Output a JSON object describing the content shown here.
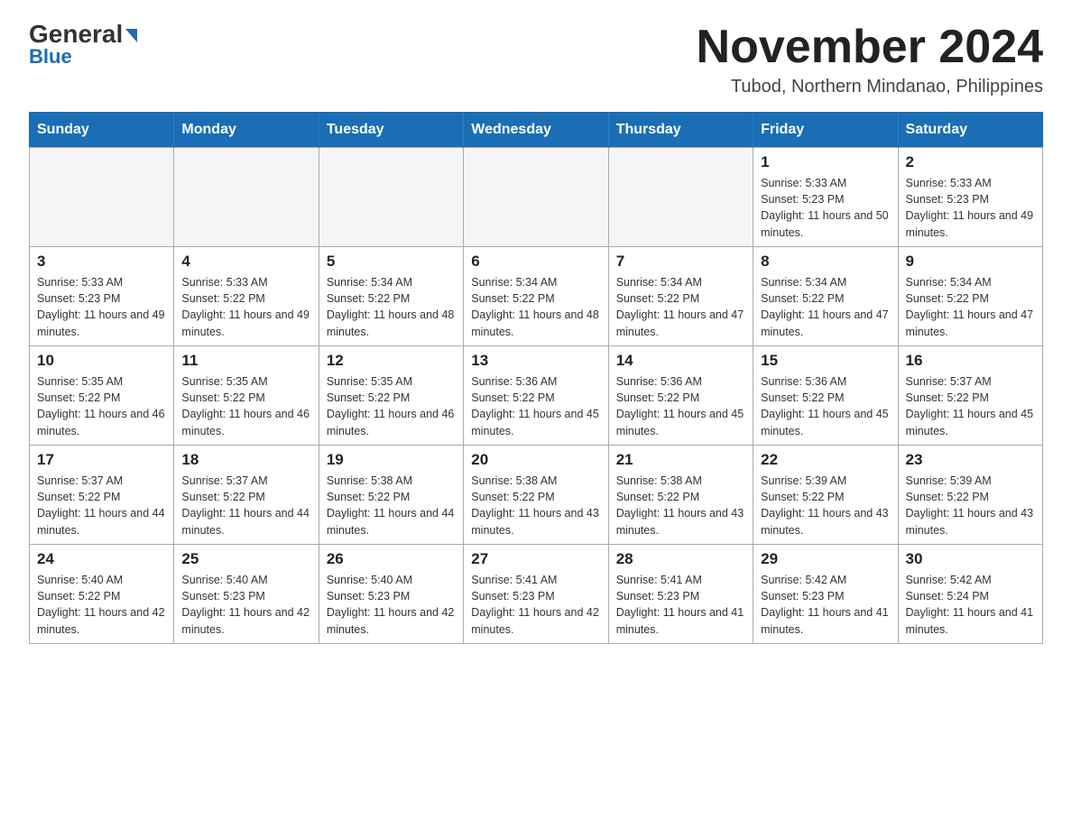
{
  "header": {
    "logo_top": "General",
    "logo_blue": "Blue",
    "month_title": "November 2024",
    "location": "Tubod, Northern Mindanao, Philippines"
  },
  "weekdays": [
    "Sunday",
    "Monday",
    "Tuesday",
    "Wednesday",
    "Thursday",
    "Friday",
    "Saturday"
  ],
  "weeks": [
    [
      {
        "day": "",
        "info": ""
      },
      {
        "day": "",
        "info": ""
      },
      {
        "day": "",
        "info": ""
      },
      {
        "day": "",
        "info": ""
      },
      {
        "day": "",
        "info": ""
      },
      {
        "day": "1",
        "info": "Sunrise: 5:33 AM\nSunset: 5:23 PM\nDaylight: 11 hours and 50 minutes."
      },
      {
        "day": "2",
        "info": "Sunrise: 5:33 AM\nSunset: 5:23 PM\nDaylight: 11 hours and 49 minutes."
      }
    ],
    [
      {
        "day": "3",
        "info": "Sunrise: 5:33 AM\nSunset: 5:23 PM\nDaylight: 11 hours and 49 minutes."
      },
      {
        "day": "4",
        "info": "Sunrise: 5:33 AM\nSunset: 5:22 PM\nDaylight: 11 hours and 49 minutes."
      },
      {
        "day": "5",
        "info": "Sunrise: 5:34 AM\nSunset: 5:22 PM\nDaylight: 11 hours and 48 minutes."
      },
      {
        "day": "6",
        "info": "Sunrise: 5:34 AM\nSunset: 5:22 PM\nDaylight: 11 hours and 48 minutes."
      },
      {
        "day": "7",
        "info": "Sunrise: 5:34 AM\nSunset: 5:22 PM\nDaylight: 11 hours and 47 minutes."
      },
      {
        "day": "8",
        "info": "Sunrise: 5:34 AM\nSunset: 5:22 PM\nDaylight: 11 hours and 47 minutes."
      },
      {
        "day": "9",
        "info": "Sunrise: 5:34 AM\nSunset: 5:22 PM\nDaylight: 11 hours and 47 minutes."
      }
    ],
    [
      {
        "day": "10",
        "info": "Sunrise: 5:35 AM\nSunset: 5:22 PM\nDaylight: 11 hours and 46 minutes."
      },
      {
        "day": "11",
        "info": "Sunrise: 5:35 AM\nSunset: 5:22 PM\nDaylight: 11 hours and 46 minutes."
      },
      {
        "day": "12",
        "info": "Sunrise: 5:35 AM\nSunset: 5:22 PM\nDaylight: 11 hours and 46 minutes."
      },
      {
        "day": "13",
        "info": "Sunrise: 5:36 AM\nSunset: 5:22 PM\nDaylight: 11 hours and 45 minutes."
      },
      {
        "day": "14",
        "info": "Sunrise: 5:36 AM\nSunset: 5:22 PM\nDaylight: 11 hours and 45 minutes."
      },
      {
        "day": "15",
        "info": "Sunrise: 5:36 AM\nSunset: 5:22 PM\nDaylight: 11 hours and 45 minutes."
      },
      {
        "day": "16",
        "info": "Sunrise: 5:37 AM\nSunset: 5:22 PM\nDaylight: 11 hours and 45 minutes."
      }
    ],
    [
      {
        "day": "17",
        "info": "Sunrise: 5:37 AM\nSunset: 5:22 PM\nDaylight: 11 hours and 44 minutes."
      },
      {
        "day": "18",
        "info": "Sunrise: 5:37 AM\nSunset: 5:22 PM\nDaylight: 11 hours and 44 minutes."
      },
      {
        "day": "19",
        "info": "Sunrise: 5:38 AM\nSunset: 5:22 PM\nDaylight: 11 hours and 44 minutes."
      },
      {
        "day": "20",
        "info": "Sunrise: 5:38 AM\nSunset: 5:22 PM\nDaylight: 11 hours and 43 minutes."
      },
      {
        "day": "21",
        "info": "Sunrise: 5:38 AM\nSunset: 5:22 PM\nDaylight: 11 hours and 43 minutes."
      },
      {
        "day": "22",
        "info": "Sunrise: 5:39 AM\nSunset: 5:22 PM\nDaylight: 11 hours and 43 minutes."
      },
      {
        "day": "23",
        "info": "Sunrise: 5:39 AM\nSunset: 5:22 PM\nDaylight: 11 hours and 43 minutes."
      }
    ],
    [
      {
        "day": "24",
        "info": "Sunrise: 5:40 AM\nSunset: 5:22 PM\nDaylight: 11 hours and 42 minutes."
      },
      {
        "day": "25",
        "info": "Sunrise: 5:40 AM\nSunset: 5:23 PM\nDaylight: 11 hours and 42 minutes."
      },
      {
        "day": "26",
        "info": "Sunrise: 5:40 AM\nSunset: 5:23 PM\nDaylight: 11 hours and 42 minutes."
      },
      {
        "day": "27",
        "info": "Sunrise: 5:41 AM\nSunset: 5:23 PM\nDaylight: 11 hours and 42 minutes."
      },
      {
        "day": "28",
        "info": "Sunrise: 5:41 AM\nSunset: 5:23 PM\nDaylight: 11 hours and 41 minutes."
      },
      {
        "day": "29",
        "info": "Sunrise: 5:42 AM\nSunset: 5:23 PM\nDaylight: 11 hours and 41 minutes."
      },
      {
        "day": "30",
        "info": "Sunrise: 5:42 AM\nSunset: 5:24 PM\nDaylight: 11 hours and 41 minutes."
      }
    ]
  ]
}
